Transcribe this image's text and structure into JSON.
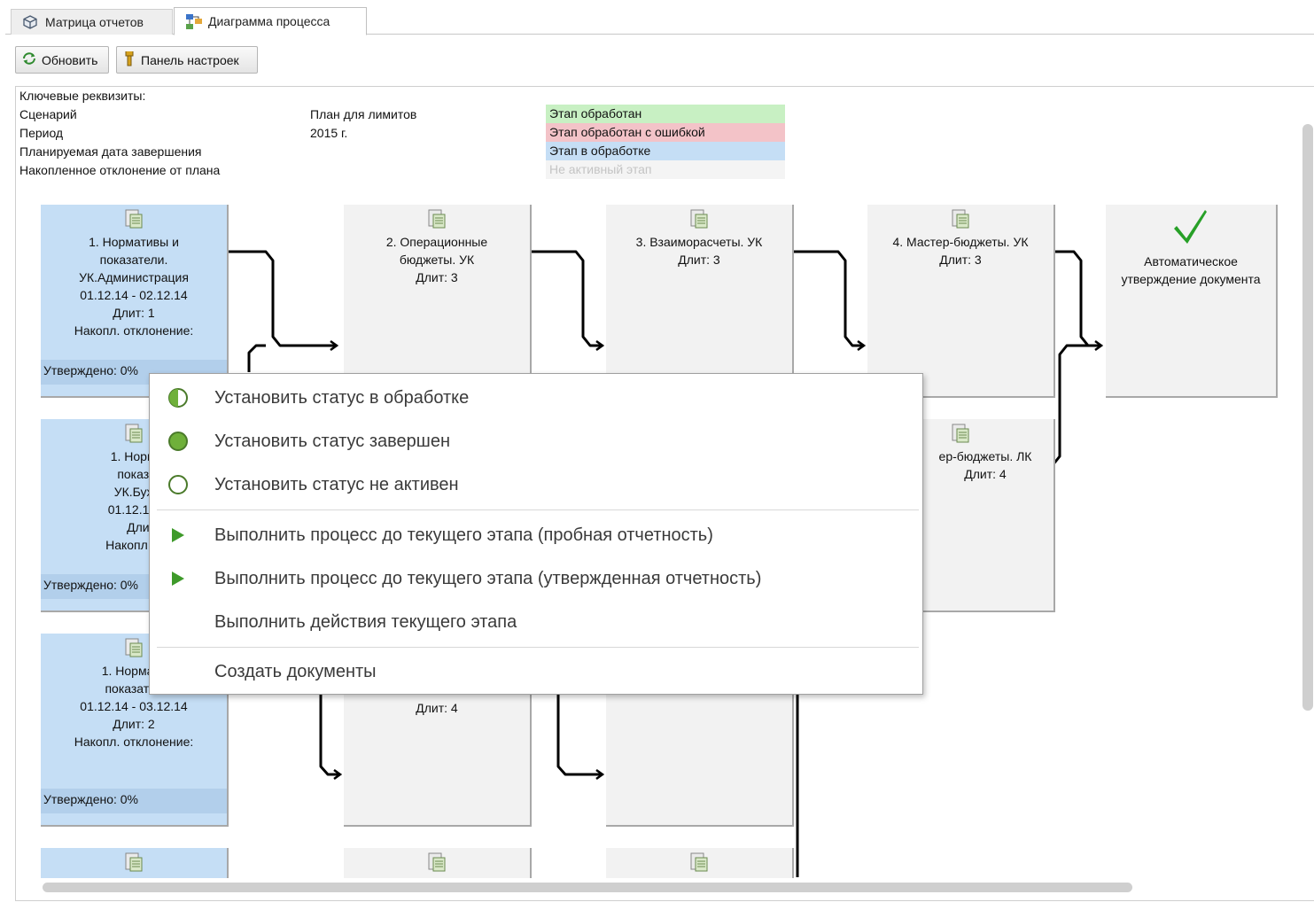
{
  "tabs": [
    {
      "label": "Матрица отчетов",
      "icon": "cube-icon",
      "active": false
    },
    {
      "label": "Диаграмма процесса",
      "icon": "process-diagram-icon",
      "active": true
    }
  ],
  "toolbar": {
    "refresh_label": "Обновить",
    "settings_label": "Панель настроек"
  },
  "info": {
    "key_attrs": "Ключевые реквизиты:",
    "scenario_label": "Сценарий",
    "scenario_value": "План для лимитов",
    "period_label": "Период",
    "period_value": "2015 г.",
    "planned_end_label": "Планируемая дата завершения",
    "deviation_label": "Накопленное отклонение от плана"
  },
  "legend": [
    {
      "label": "Этап обработан",
      "color": "#c8f0c3"
    },
    {
      "label": "Этап обработан с ошибкой",
      "color": "#f3c3c8"
    },
    {
      "label": "Этап в обработке",
      "color": "#c5def5"
    },
    {
      "label": "Не активный этап",
      "color": "#f4f4f4"
    }
  ],
  "stages": {
    "s1a": {
      "text": "1. Нормативы и\nпоказатели.\nУК.Администрация\n01.12.14 - 02.12.14\nДлит: 1\nНакопл. отклонение:",
      "approved": "Утверждено: 0%"
    },
    "s2a": {
      "text": "2. Операционные\nбюджеты. УК\nДлит: 3"
    },
    "s3a": {
      "text": "3. Взаиморасчеты. УК\nДлит: 3"
    },
    "s4a": {
      "text": "4. Мастер-бюджеты. УК\nДлит: 3"
    },
    "auto": {
      "text": "Автоматическое\nутверждение документа"
    },
    "s1b": {
      "text": "1. Нормати\nпоказате\nУК.Бухгал\n01.12.14 - 0:\nДлит:\nНакопл. откл",
      "approved": "Утверждено: 0%"
    },
    "s4b": {
      "text": "ер-бюджеты. ЛК\nДлит: 4"
    },
    "s1c": {
      "text": "1. Нормати\nпоказател\n01.12.14 - 03.12.14\nДлит: 2\nНакопл. отклонение:",
      "approved": "Утверждено: 0%"
    },
    "s2c": {
      "text": "Длит: 4"
    }
  },
  "context_menu": [
    {
      "label": "Установить статус в обработке",
      "icon": "half-circle-status-icon"
    },
    {
      "label": "Установить статус завершен",
      "icon": "green-circle-status-icon"
    },
    {
      "label": "Установить статус не активен",
      "icon": "empty-circle-status-icon"
    },
    {
      "label": "Выполнить процесс до текущего этапа (пробная отчетность)",
      "icon": "play-icon"
    },
    {
      "label": "Выполнить процесс до текущего этапа (утвержденная отчетность)",
      "icon": "play-icon"
    },
    {
      "label": "Выполнить действия текущего этапа",
      "icon": ""
    },
    {
      "label": "Создать документы",
      "icon": ""
    }
  ]
}
